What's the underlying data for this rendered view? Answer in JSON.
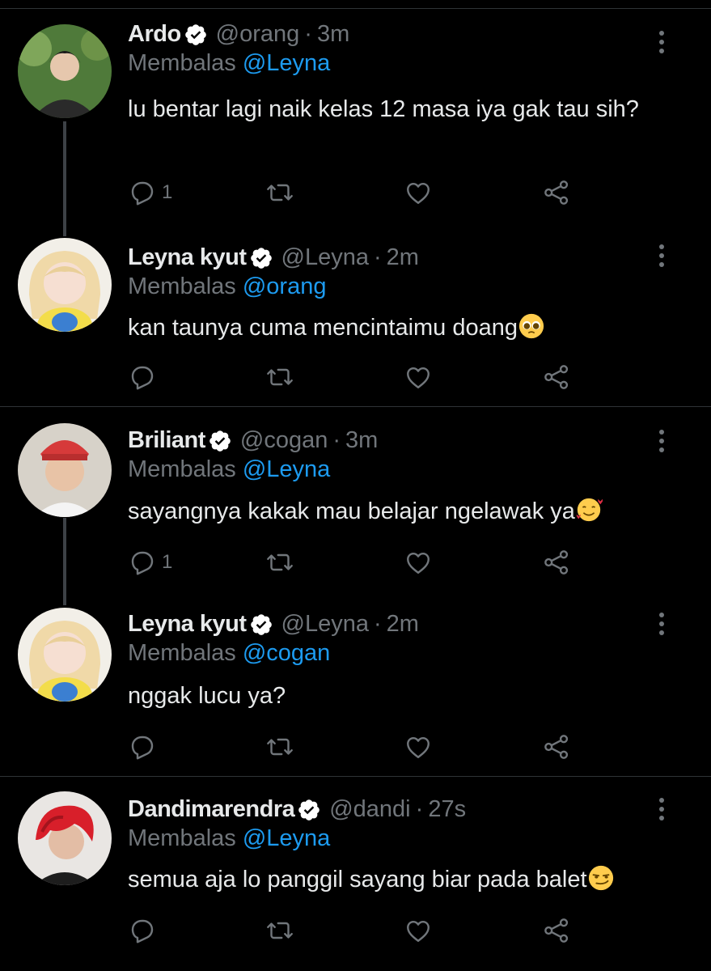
{
  "tweets": [
    {
      "name": "Ardo",
      "handle": "@orang",
      "dot": "·",
      "time": "3m",
      "replying_prefix": "Membalas",
      "replying_to": "@Leyna",
      "text": "lu bentar lagi naik kelas 12 masa iya gak tau sih?",
      "reply_count": "1"
    },
    {
      "name": "Leyna kyut",
      "handle": "@Leyna",
      "dot": "·",
      "time": "2m",
      "replying_prefix": "Membalas",
      "replying_to": "@orang",
      "text": "kan taunya cuma mencintaimu doang",
      "emoji": "pleading-face-emoji"
    },
    {
      "name": "Briliant",
      "handle": "@cogan",
      "dot": "·",
      "time": "3m",
      "replying_prefix": "Membalas",
      "replying_to": "@Leyna",
      "text": "sayangnya kakak mau belajar ngelawak ya",
      "emoji": "smiling-face-with-hearts-emoji",
      "reply_count": "1"
    },
    {
      "name": "Leyna kyut",
      "handle": "@Leyna",
      "dot": "·",
      "time": "2m",
      "replying_prefix": "Membalas",
      "replying_to": "@cogan",
      "text": "nggak lucu ya?"
    },
    {
      "name": "Dandimarendra",
      "handle": "@dandi",
      "dot": "·",
      "time": "27s",
      "replying_prefix": "Membalas",
      "replying_to": "@Leyna",
      "text": "semua aja lo panggil sayang biar pada balet",
      "emoji": "smirking-face-emoji"
    }
  ],
  "colors": {
    "background": "#000000",
    "text": "#e7e9ea",
    "muted": "#71767b",
    "link": "#1d9bf0",
    "separator": "#2f3336"
  }
}
